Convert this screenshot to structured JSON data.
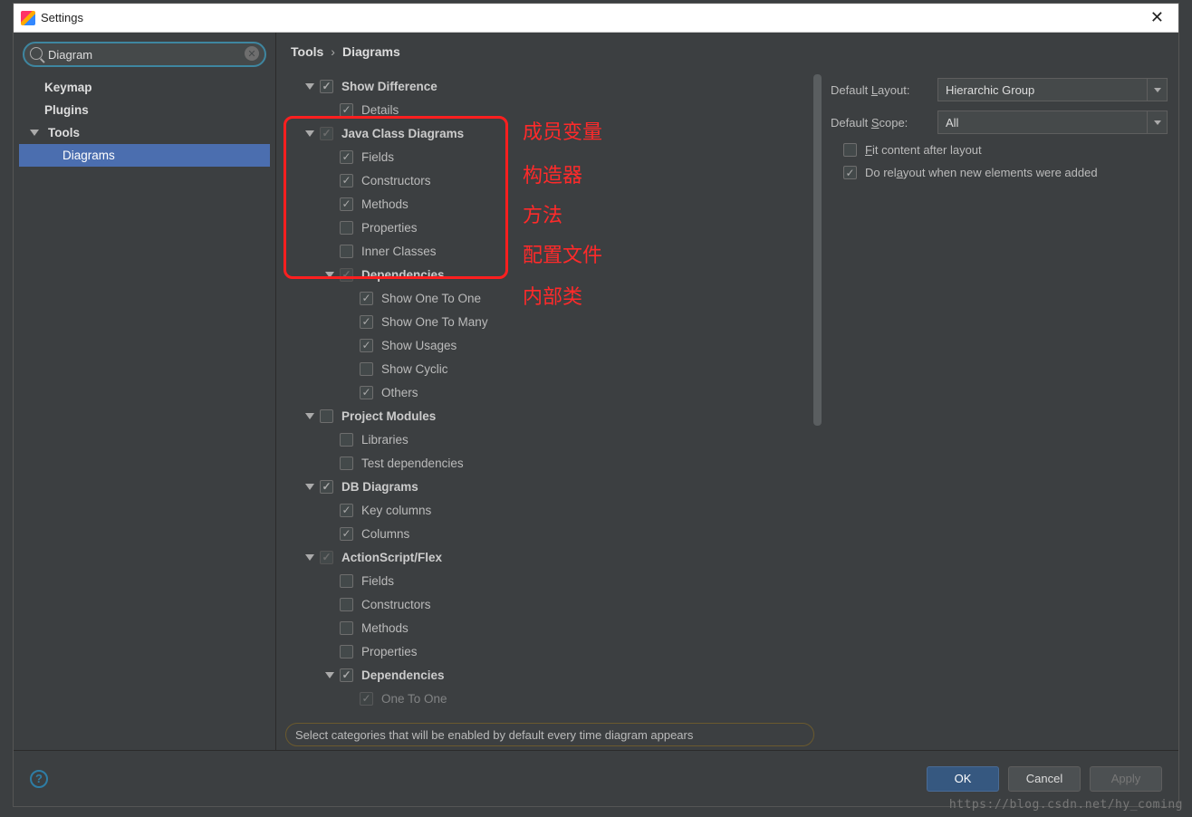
{
  "window": {
    "title": "Settings"
  },
  "search": {
    "value": "Diagram"
  },
  "nav": {
    "keymap": "Keymap",
    "plugins": "Plugins",
    "tools": "Tools",
    "diagrams": "Diagrams"
  },
  "breadcrumb": {
    "tools": "Tools",
    "diagrams": "Diagrams"
  },
  "tree": {
    "show_difference": "Show Difference",
    "details": "Details",
    "java_class_diagrams": "Java Class Diagrams",
    "fields": "Fields",
    "constructors": "Constructors",
    "methods": "Methods",
    "properties": "Properties",
    "inner_classes": "Inner Classes",
    "dependencies": "Dependencies",
    "show_one_to_one": "Show One To One",
    "show_one_to_many": "Show One To Many",
    "show_usages": "Show Usages",
    "show_cyclic": "Show Cyclic",
    "others": "Others",
    "project_modules": "Project Modules",
    "libraries": "Libraries",
    "test_dependencies": "Test dependencies",
    "db_diagrams": "DB Diagrams",
    "key_columns": "Key columns",
    "columns": "Columns",
    "actionscript_flex": "ActionScript/Flex",
    "dependencies2": "Dependencies",
    "one_to_one": "One To One"
  },
  "right": {
    "default_layout_label": "Default Layout:",
    "default_layout_value": "Hierarchic Group",
    "default_scope_label": "Default Scope:",
    "default_scope_value": "All",
    "fit_content": "Fit content after layout",
    "relayout": "Do relayout when new elements were added"
  },
  "annotations": {
    "member_vars": "成员变量",
    "constructors": "构造器",
    "methods": "方法",
    "config_files": "配置文件",
    "inner_classes": "内部类"
  },
  "hint": "Select categories that will be enabled by default every time diagram appears",
  "buttons": {
    "ok": "OK",
    "cancel": "Cancel",
    "apply": "Apply"
  },
  "watermark": "https://blog.csdn.net/hy_coming"
}
